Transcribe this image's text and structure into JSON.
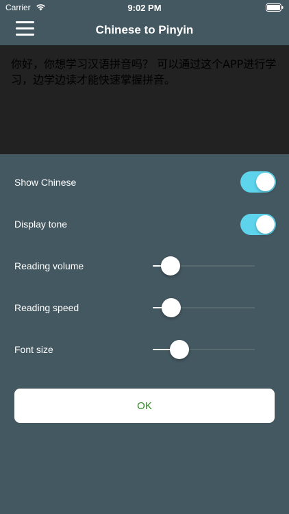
{
  "status_bar": {
    "carrier": "Carrier",
    "time": "9:02 PM",
    "wifi_icon": "wifi-icon",
    "battery_icon": "battery-icon"
  },
  "nav": {
    "title": "Chinese to Pinyin",
    "menu_icon": "hamburger-menu-icon"
  },
  "text_panel": {
    "text": "你好，你想学习汉语拼音吗？ 可以通过这个APP进行学习，边学边读才能快速掌握拼音。"
  },
  "settings": {
    "show_chinese": {
      "label": "Show Chinese",
      "on": true
    },
    "display_tone": {
      "label": "Display tone",
      "on": true
    },
    "reading_volume": {
      "label": "Reading volume",
      "value": 0.08
    },
    "reading_speed": {
      "label": "Reading speed",
      "value": 0.09
    },
    "font_size": {
      "label": "Font size",
      "value": 0.17
    }
  },
  "ok_button": {
    "label": "OK"
  },
  "colors": {
    "background": "#445861",
    "toggle_on": "#5ed4ec",
    "text_panel": "#222222",
    "ok_text": "#2e8b22"
  }
}
